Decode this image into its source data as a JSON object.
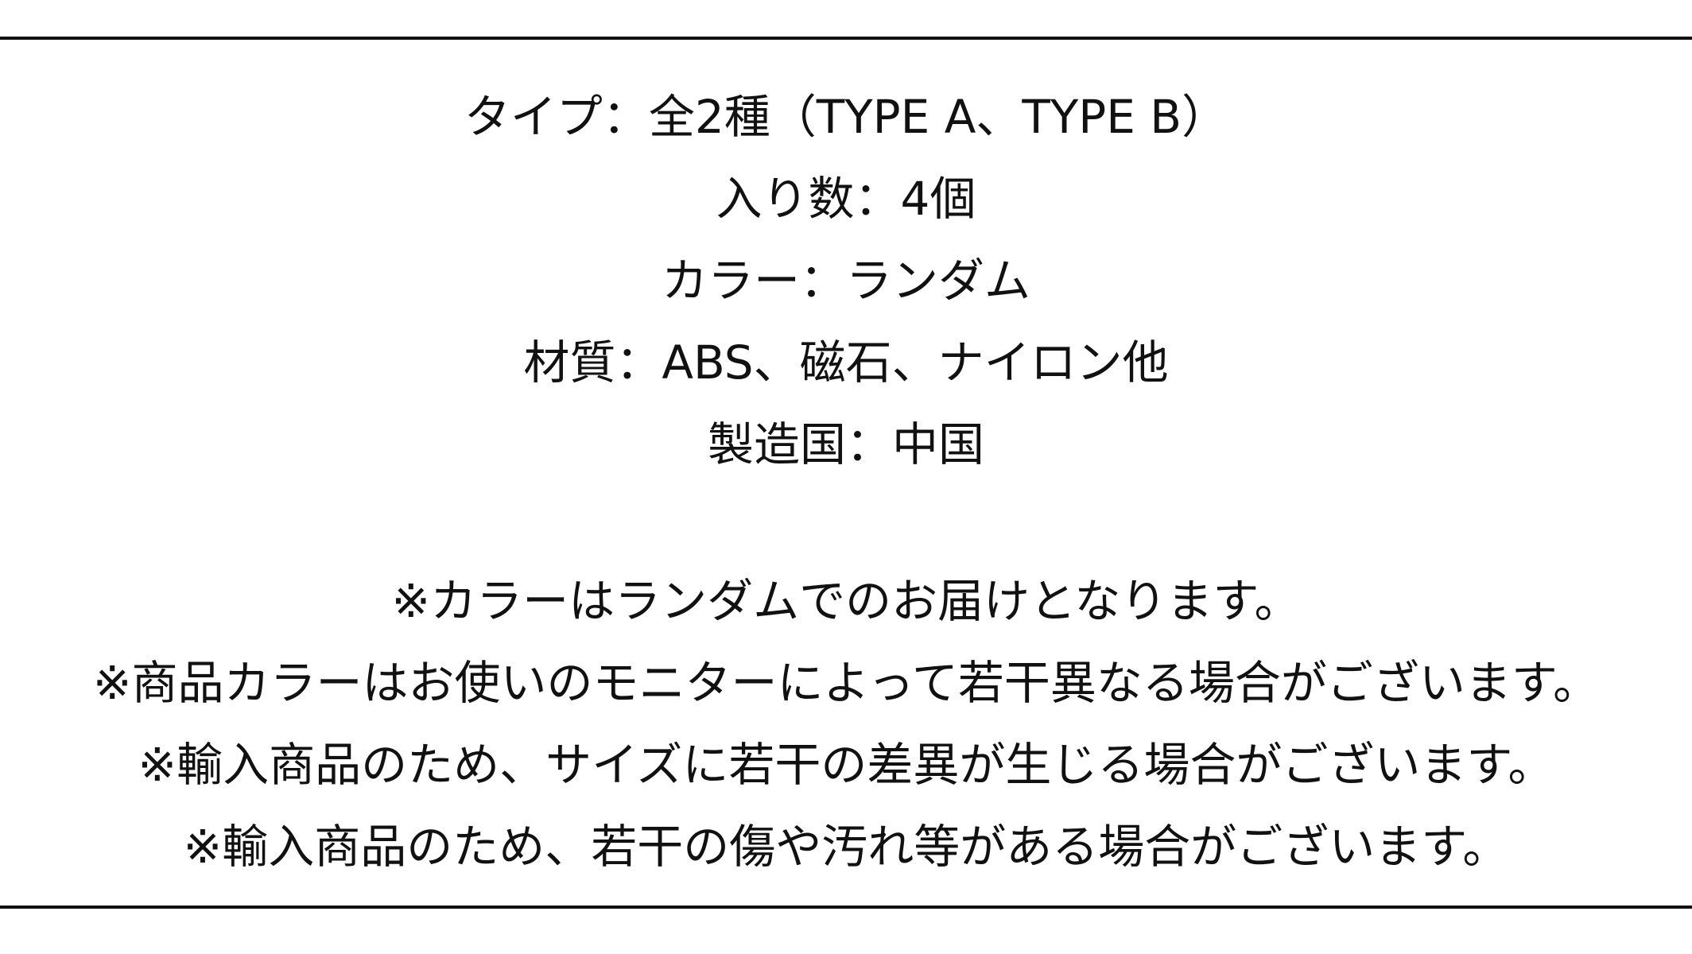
{
  "specs": {
    "lines": [
      "タイプ：全2種（TYPE A、TYPE B）",
      "入り数：4個",
      "カラー：ランダム",
      "材質：ABS、磁石、ナイロン他",
      "製造国：中国"
    ]
  },
  "notes": {
    "lines": [
      "※カラーはランダムでのお届けとなります。",
      "※商品カラーはお使いのモニターによって若干異なる場合がございます。",
      "※輸入商品のため、サイズに若干の差異が生じる場合がございます。",
      "※輸入商品のため、若干の傷や汚れ等がある場合がございます。"
    ]
  }
}
